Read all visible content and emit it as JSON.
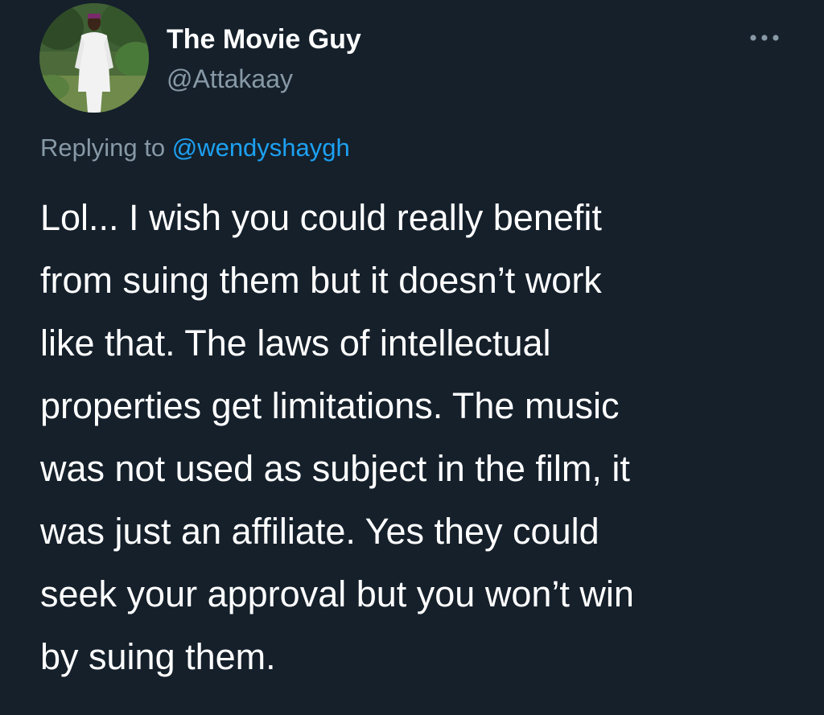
{
  "author": {
    "display_name": "The Movie Guy",
    "handle": "@Attakaay",
    "avatar": "profile-photo"
  },
  "more_icon": "more-horizontal-icon",
  "reply": {
    "prefix": "Replying to ",
    "mention": "@wendyshaygh"
  },
  "tweet": {
    "lines": [
      "Lol... I wish you could really benefit",
      "from suing them but it doesn’t work",
      "like that. The laws of intellectual",
      "properties get limitations. The music",
      "was not used as subject in the film, it",
      "was just an affiliate. Yes they could",
      "seek your approval but you won’t win",
      "by suing them."
    ]
  },
  "colors": {
    "background": "#15202b",
    "primary_text": "#ffffff",
    "secondary_text": "#8899a6",
    "accent": "#1da1f2"
  }
}
